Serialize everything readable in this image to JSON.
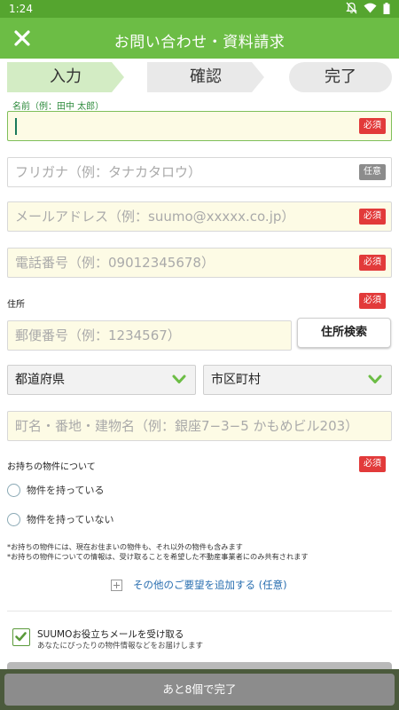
{
  "status_bar": {
    "time": "1:24",
    "icons": [
      "bell-off-icon",
      "wifi-icon",
      "battery-icon"
    ]
  },
  "app_bar": {
    "title": "お問い合わせ・資料請求",
    "close_icon": "close-icon"
  },
  "steps": [
    {
      "label": "入力",
      "active": true
    },
    {
      "label": "確認",
      "active": false
    },
    {
      "label": "完了",
      "active": false
    }
  ],
  "form": {
    "name": {
      "label": "名前（例：田中 太郎）",
      "value": "",
      "badge": "必須"
    },
    "furigana": {
      "placeholder": "フリガナ（例：タナカタロウ）",
      "badge": "任意"
    },
    "email": {
      "placeholder": "メールアドレス（例：suumo@xxxxx.co.jp）",
      "badge": "必須"
    },
    "phone": {
      "placeholder": "電話番号（例：09012345678）",
      "badge": "必須"
    },
    "address": {
      "label": "住所",
      "badge": "必須",
      "postal_placeholder": "郵便番号（例：1234567）",
      "search_button": "住所検索",
      "prefecture": "都道府県",
      "city": "市区町村",
      "street_placeholder": "町名・番地・建物名（例：銀座7−3−5 かもめビル203）"
    },
    "property": {
      "label": "お持ちの物件について",
      "badge": "必須",
      "options": [
        "物件を持っている",
        "物件を持っていない"
      ]
    },
    "notes": [
      "*お持ちの物件には、現在お住まいの物件も、それ以外の物件も含みます",
      "*お持ちの物件についての情報は、受け取ることを希望した不動産事業者にのみ共有されます"
    ],
    "add_request": "その他のご要望を追加する (任意)",
    "newsletter": {
      "title": "SUUMOお役立ちメールを受け取る",
      "subtitle": "あなたにぴったりの物件情報などをお届けします",
      "checked": true
    }
  },
  "bottom_button": "あと8個で完了",
  "colors": {
    "header": "#6cbd45",
    "status_bar": "#55a52f",
    "required_badge": "#e23a3a",
    "optional_badge": "#8c8c8c",
    "input_bg": "#fdfbe5",
    "link": "#2a6fb0",
    "check": "#5a9a3a"
  }
}
